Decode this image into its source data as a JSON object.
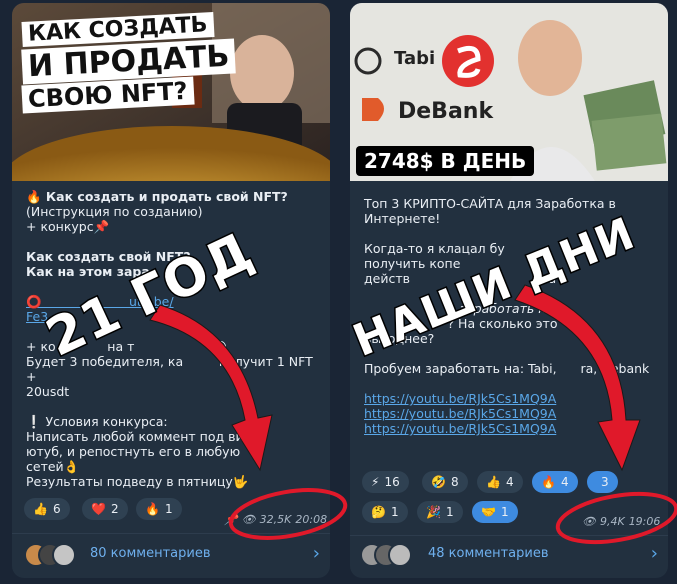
{
  "left": {
    "thumb_title_lines": [
      "КАК СОЗДАТЬ",
      "И ПРОДАТЬ",
      "СВОЮ NFT?"
    ],
    "post_lines": [
      {
        "text": "🔥 Как создать и продать свой NFT?",
        "style": "bold"
      },
      {
        "text": "(Инструкция по созданию)",
        "style": ""
      },
      {
        "text": "+ конкурс📌",
        "style": ""
      },
      {
        "text": "",
        "style": ""
      },
      {
        "text": "Как создать свой NFT?",
        "style": "bold"
      },
      {
        "text": "Как на этом зара",
        "style": "bold"
      },
      {
        "text": "",
        "style": ""
      },
      {
        "text": "⭕                      utu.be/",
        "style": "link"
      },
      {
        "text": "Fe3",
        "style": "link"
      },
      {
        "text": "",
        "style": ""
      },
      {
        "text": "+ ко             на т                    😏",
        "style": ""
      },
      {
        "text": "Будет 3 победителя, ка         получит 1 NFT +",
        "style": ""
      },
      {
        "text": "20usdt",
        "style": ""
      },
      {
        "text": "",
        "style": ""
      },
      {
        "text": "❕ Условия конкурса:",
        "style": ""
      },
      {
        "text": "Написать любой коммент под вид",
        "style": ""
      },
      {
        "text": "ютуб, и репостнуть его в любую",
        "style": ""
      },
      {
        "text": "сетей👌",
        "style": ""
      },
      {
        "text": "Результаты подведу в пятницу🤟",
        "style": ""
      }
    ],
    "reactions": [
      {
        "icon": "👍",
        "count": "6",
        "active": false
      },
      {
        "icon": "❤️",
        "count": "2",
        "active": false
      },
      {
        "icon": "🔥",
        "count": "1",
        "active": false
      }
    ],
    "views": "32,5K",
    "time": "20:08",
    "comments_label": "80 комментариев",
    "overlay_label": "21 ГОД"
  },
  "right": {
    "thumb_logos": [
      "Tabi",
      "DeBank"
    ],
    "thumb_banner": "2748$ В ДЕНЬ",
    "post_lines": [
      {
        "text": "Топ 3 КРИПТО-САЙТА для Заработка в",
        "style": ""
      },
      {
        "text": "Интернете!",
        "style": ""
      },
      {
        "text": "",
        "style": ""
      },
      {
        "text": "Когда-то я клацал бу",
        "style": ""
      },
      {
        "text": "получить копе",
        "style": ""
      },
      {
        "text": "действ                               в, а",
        "style": ""
      },
      {
        "text": "",
        "style": ""
      },
      {
        "text": "                        заработать на",
        "style": "italic"
      },
      {
        "text": "                     ? На сколько это",
        "style": ""
      },
      {
        "text": "выгоднее?",
        "style": ""
      },
      {
        "text": "",
        "style": ""
      },
      {
        "text": "Пробуем заработать на: Tabi,      ra, Debank",
        "style": ""
      },
      {
        "text": "",
        "style": ""
      },
      {
        "text": "https://youtu.be/RJk5Cs1MQ9A",
        "style": "link"
      },
      {
        "text": "https://youtu.be/RJk5Cs1MQ9A",
        "style": "link"
      },
      {
        "text": "https://youtu.be/RJk5Cs1MQ9A",
        "style": "link"
      }
    ],
    "reactions_row1": [
      {
        "icon": "⚡",
        "count": "16",
        "active": false
      },
      {
        "icon": "🤣",
        "count": "8",
        "active": false
      },
      {
        "icon": "👍",
        "count": "4",
        "active": false
      },
      {
        "icon": "🔥",
        "count": "4",
        "active": true
      },
      {
        "icon": "",
        "count": "3",
        "active": true
      }
    ],
    "reactions_row2": [
      {
        "icon": "🤔",
        "count": "1",
        "active": false
      },
      {
        "icon": "🎉",
        "count": "1",
        "active": false
      },
      {
        "icon": "🤝",
        "count": "1",
        "active": true
      }
    ],
    "views": "9,4K",
    "time": "19:06",
    "comments_label": "48 комментариев",
    "overlay_label": "НАШИ ДНИ"
  },
  "colors": {
    "accent": "#5aa7e8",
    "arrow_red": "#e0192a",
    "card_bg": "#22303f",
    "page_bg": "#1a2535"
  }
}
